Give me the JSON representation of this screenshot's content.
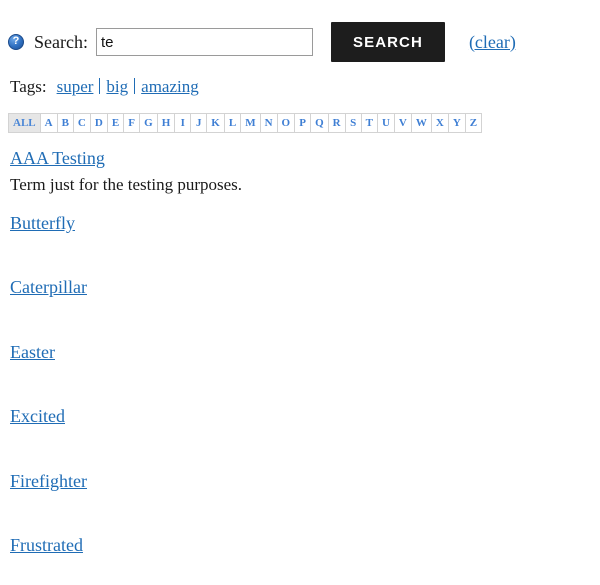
{
  "search": {
    "help_icon": "help-question-icon",
    "label": "Search:",
    "value": "te",
    "placeholder": "",
    "button_label": "SEARCH",
    "clear_label": "(clear)"
  },
  "tags": {
    "label": "Tags:",
    "items": [
      {
        "label": "super"
      },
      {
        "label": "big"
      },
      {
        "label": "amazing"
      }
    ]
  },
  "alphabet": {
    "selected": "ALL",
    "items": [
      "ALL",
      "A",
      "B",
      "C",
      "D",
      "E",
      "F",
      "G",
      "H",
      "I",
      "J",
      "K",
      "L",
      "M",
      "N",
      "O",
      "P",
      "Q",
      "R",
      "S",
      "T",
      "U",
      "V",
      "W",
      "X",
      "Y",
      "Z"
    ]
  },
  "results": [
    {
      "title": "AAA Testing",
      "description": "Term just for the testing purposes."
    },
    {
      "title": "Butterfly",
      "description": ""
    },
    {
      "title": "Caterpillar",
      "description": ""
    },
    {
      "title": "Easter",
      "description": ""
    },
    {
      "title": "Excited",
      "description": ""
    },
    {
      "title": "Firefighter",
      "description": ""
    },
    {
      "title": "Frustrated",
      "description": ""
    }
  ],
  "colors": {
    "link": "#1f6cb5",
    "alpha_link": "#3f7fd4",
    "button_bg": "#1d1d1d",
    "selected_bg": "#e6e6e6",
    "text": "#1a1a1a"
  }
}
